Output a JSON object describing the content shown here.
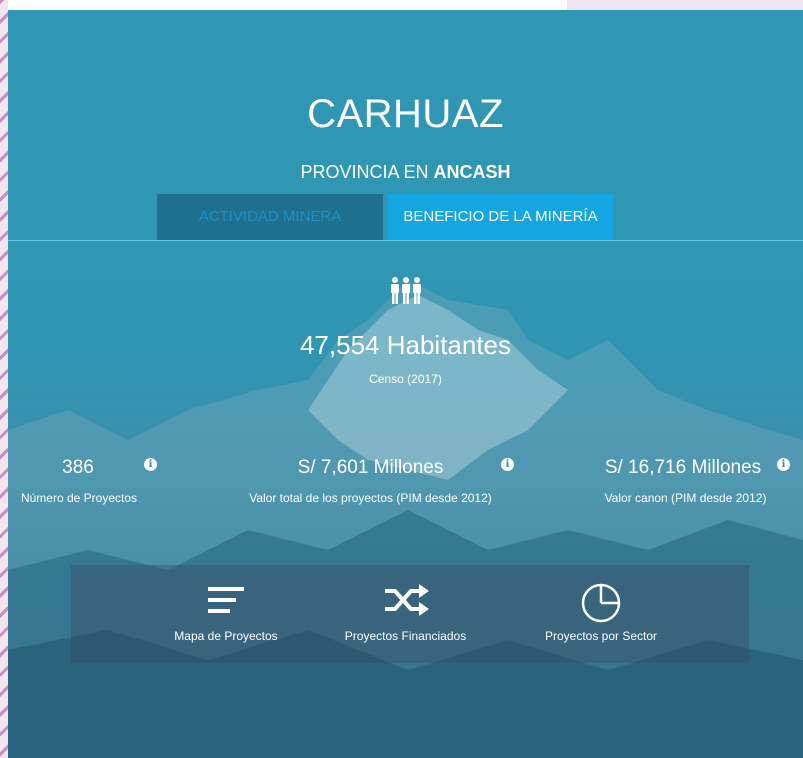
{
  "header": {
    "title": "CARHUAZ",
    "subtitle_prefix": "PROVINCIA EN",
    "subtitle_region": "ANCASH"
  },
  "tabs": [
    {
      "label": "ACTIVIDAD MINERA",
      "active": false
    },
    {
      "label": "BENEFICIO DE LA MINERÍA",
      "active": true
    }
  ],
  "population": {
    "icon": "people-icon",
    "value": "47,554 Habitantes",
    "source": "Censo (2017)"
  },
  "stats": [
    {
      "value": "386",
      "label": "Número de Proyectos",
      "info_icon": "info-icon"
    },
    {
      "value": "S/ 7,601 Millones",
      "label": "Valor total de los proyectos (PIM desde 2012)",
      "info_icon": "info-icon"
    },
    {
      "value": "S/ 16,716 Millones",
      "label": "Valor canon (PIM desde 2012)",
      "info_icon": "info-icon"
    }
  ],
  "actions": [
    {
      "label": "Mapa de Proyectos",
      "icon": "list-lines-icon"
    },
    {
      "label": "Proyectos Financiados",
      "icon": "shuffle-icon"
    },
    {
      "label": "Proyectos por Sector",
      "icon": "pie-chart-icon"
    }
  ],
  "colors": {
    "panel": "#2f97b5",
    "tab_inactive_bg": "#1f6f8e",
    "tab_active_bg": "#14a6e3",
    "text": "#ffffff"
  }
}
